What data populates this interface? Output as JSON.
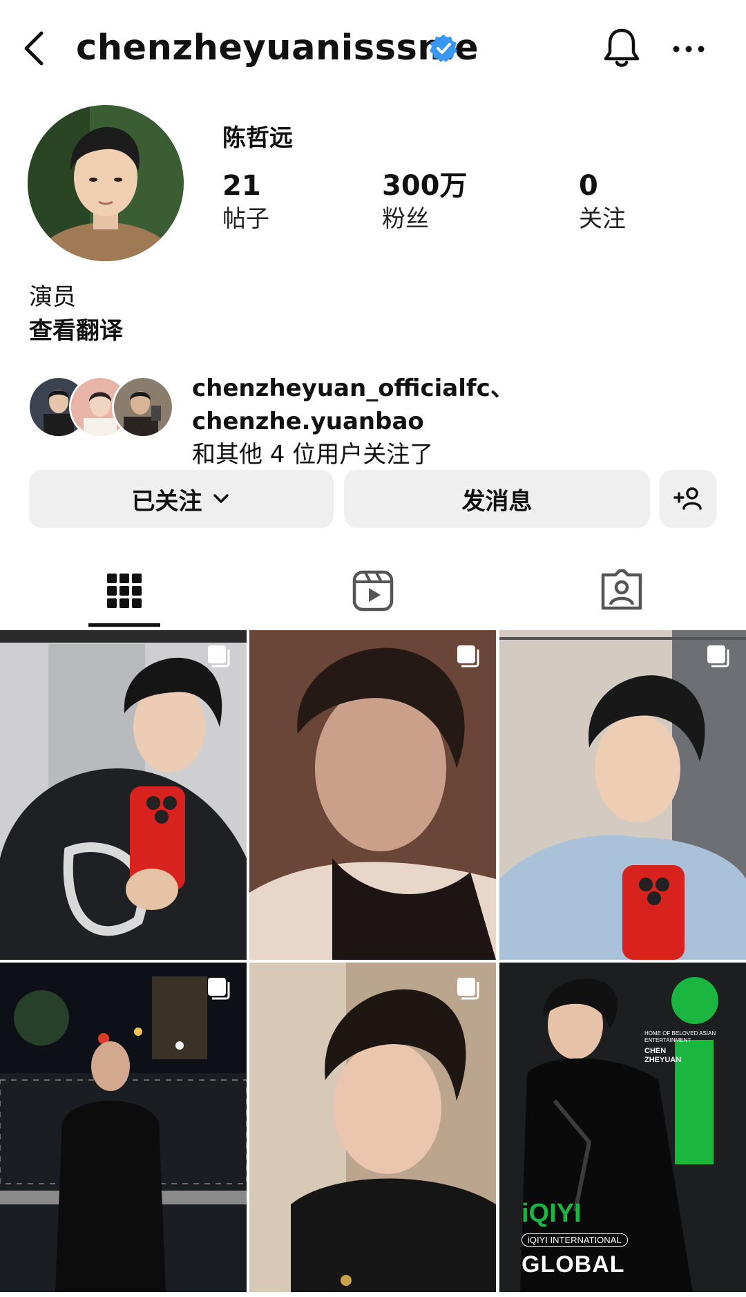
{
  "header": {
    "username": "chenzheyuanisssme",
    "back_icon": "chevron-left-icon",
    "verified_icon": "verified-badge-icon",
    "bell_icon": "bell-icon",
    "more_icon": "more-horizontal-icon"
  },
  "profile": {
    "display_name": "陈哲远",
    "stats": [
      {
        "value": "21",
        "label": "帖子"
      },
      {
        "value": "300万",
        "label": "粉丝"
      },
      {
        "value": "0",
        "label": "关注"
      }
    ],
    "bio": "演员",
    "translate": "查看翻译"
  },
  "mutuals": {
    "names": "chenzheyuan_officialfc、chenzhe.yuanbao",
    "suffix": "和其他 4 位用户关注了"
  },
  "actions": {
    "following_label": "已关注",
    "message_label": "发消息",
    "add_user_icon": "add-person-icon"
  },
  "tabs": [
    {
      "name": "grid-icon",
      "active": true
    },
    {
      "name": "reels-icon",
      "active": false
    },
    {
      "name": "tagged-icon",
      "active": false
    }
  ],
  "post_6": {
    "brand": "iQIYI",
    "sub_brand": "iQIYI INTERNATIONAL",
    "global": "GLOBAL",
    "tagline": "HOME OF BELOVED ASIAN ENTERTAINMENT",
    "person": "CHEN ZHEYUAN"
  },
  "colors": {
    "verified": "#3897f0",
    "button_bg": "#efefef",
    "iqiyi_green": "#1ab640"
  }
}
